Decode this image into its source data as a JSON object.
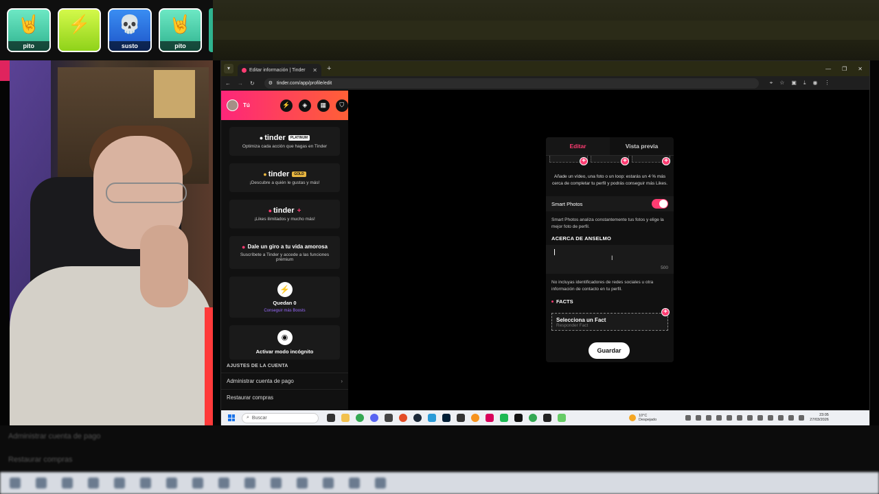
{
  "alerts": [
    {
      "label": "pito",
      "emoji": "🤘",
      "color": "green"
    },
    {
      "label": "",
      "emoji": "⚡",
      "color": "lime"
    },
    {
      "label": "susto",
      "emoji": "💀",
      "color": "blue"
    },
    {
      "label": "pito",
      "emoji": "🤘",
      "color": "green"
    }
  ],
  "browser": {
    "tab_title": "Editar información | Tinder",
    "url": "tinder.com/app/profile/edit"
  },
  "sidebar": {
    "user_label": "Tú",
    "promos": [
      {
        "brand": "tinder",
        "badge": "PLATINUM",
        "subtitle": "Optimiza cada acción que hagas en Tinder"
      },
      {
        "brand": "tinder",
        "badge": "GOLD",
        "subtitle": "¡Descubre a quién le gustas y más!"
      },
      {
        "brand": "tinder",
        "badge": "+",
        "subtitle": "¡Likes ilimitados y mucho más!"
      }
    ],
    "premium": {
      "title": "Dale un giro a tu vida amorosa",
      "subtitle": "Suscríbete a Tinder y accede a las funciones prémium"
    },
    "boost": {
      "remaining": "Quedan 0",
      "link": "Conseguir más Boosts"
    },
    "incognito": {
      "label": "Activar modo incógnito"
    },
    "settings_heading": "AJUSTES DE LA CUENTA",
    "settings": [
      {
        "label": "Administrar cuenta de pago",
        "chevron": "›"
      },
      {
        "label": "Restaurar compras",
        "chevron": ""
      }
    ]
  },
  "edit": {
    "tabs": [
      "Editar",
      "Vista previa"
    ],
    "active_tab": "Editar",
    "media_hint": "Añade un vídeo, una foto o un loop: estarás un 4 % más cerca de completar tu perfil y podrás conseguir más Likes.",
    "smart_photos_label": "Smart Photos",
    "smart_photos_on": true,
    "smart_photos_desc": "Smart Photos analiza constantemente tus fotos y elige la mejor foto de perfil.",
    "about_heading": "ACERCA DE ANSELMO",
    "about_value": "",
    "about_count": "500",
    "about_note": "No incluyas identificadores de redes sociales u otra información de contacto en tu perfil.",
    "facts_heading": "FACTS",
    "fact_title": "Selecciona un Fact",
    "fact_sub": "Responder Fact",
    "save_label": "Guardar"
  },
  "taskbar": {
    "search_placeholder": "Buscar",
    "weather_temp": "10°C",
    "weather_desc": "Despejado",
    "time": "23:05",
    "date": "27/03/2026"
  },
  "bg": {
    "ghost_1": "Administrar cuenta de pago",
    "ghost_2": "Restaurar compras"
  },
  "colors": {
    "accent": "#fe3c72",
    "gradient_start": "#fd267a",
    "gradient_end": "#ff6036"
  }
}
